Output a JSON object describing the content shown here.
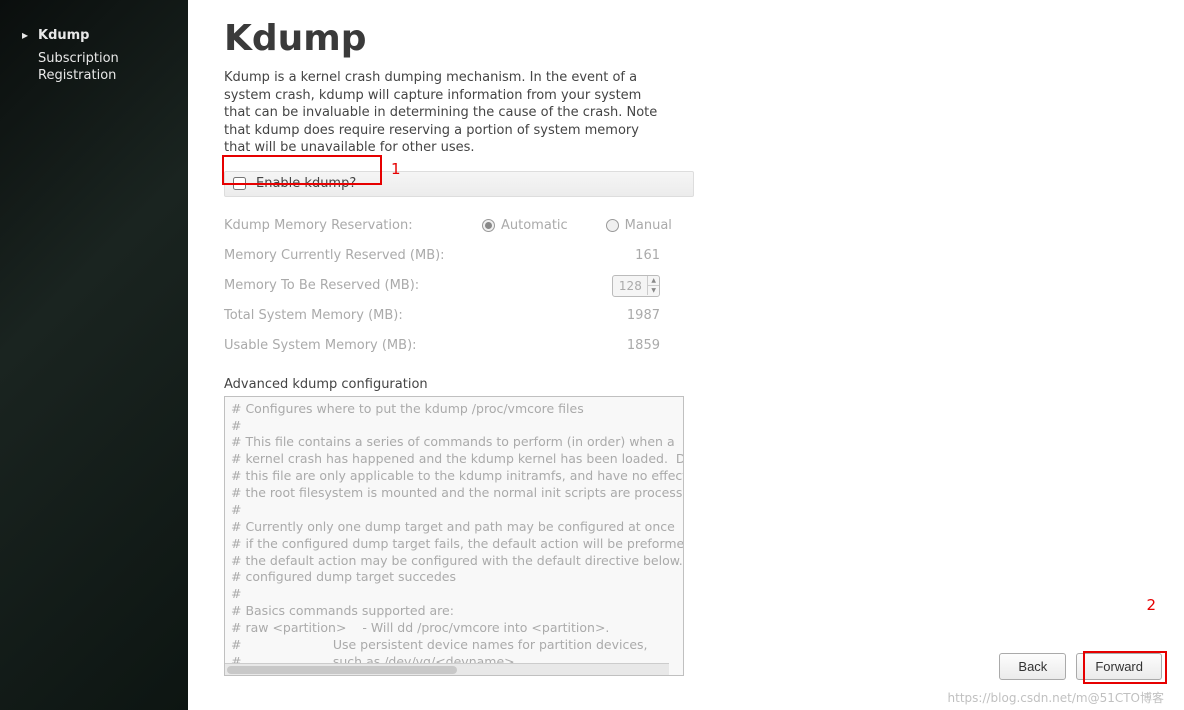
{
  "sidebar": {
    "items": [
      {
        "label": "Kdump",
        "active": true
      },
      {
        "label": "Subscription Registration",
        "active": false
      }
    ]
  },
  "page": {
    "title": "Kdump",
    "description": "Kdump is a kernel crash dumping mechanism. In the event of a system crash, kdump will capture information from your system that can be invaluable in determining the cause of the crash. Note that kdump does require reserving a portion of system memory that will be unavailable for other uses."
  },
  "enable_checkbox": {
    "label": "Enable kdump?",
    "checked": false
  },
  "annotations": {
    "first": "1",
    "second": "2"
  },
  "form": {
    "reservation_label": "Kdump Memory Reservation:",
    "reservation_mode": "Automatic",
    "reservation_options": {
      "auto": "Automatic",
      "manual": "Manual"
    },
    "currently_reserved_label": "Memory Currently Reserved (MB):",
    "currently_reserved_value": "161",
    "to_be_reserved_label": "Memory To Be Reserved (MB):",
    "to_be_reserved_value": "128",
    "total_memory_label": "Total System Memory (MB):",
    "total_memory_value": "1987",
    "usable_memory_label": "Usable System Memory (MB):",
    "usable_memory_value": "1859"
  },
  "advanced": {
    "label": "Advanced kdump configuration",
    "content": "# Configures where to put the kdump /proc/vmcore files\n#\n# This file contains a series of commands to perform (in order) when a\n# kernel crash has happened and the kdump kernel has been loaded.  Direc\n# this file are only applicable to the kdump initramfs, and have no effect if\n# the root filesystem is mounted and the normal init scripts are processed\n#\n# Currently only one dump target and path may be configured at once\n# if the configured dump target fails, the default action will be preformed\n# the default action may be configured with the default directive below.  If th\n# configured dump target succedes\n#\n# Basics commands supported are:\n# raw <partition>    - Will dd /proc/vmcore into <partition>.\n#                       Use persistent device names for partition devices,\n#                       such as /dev/vg/<devname>.\n#\n# nfs <nfs mount>        - Will mount fs and copy /proc/vmcore to\n#                       <mnt>/var/crash/%HOST-%DATE/, supports DNS."
  },
  "footer": {
    "back": "Back",
    "forward": "Forward"
  },
  "watermark": "https://blog.csdn.net/m@51CTO博客"
}
